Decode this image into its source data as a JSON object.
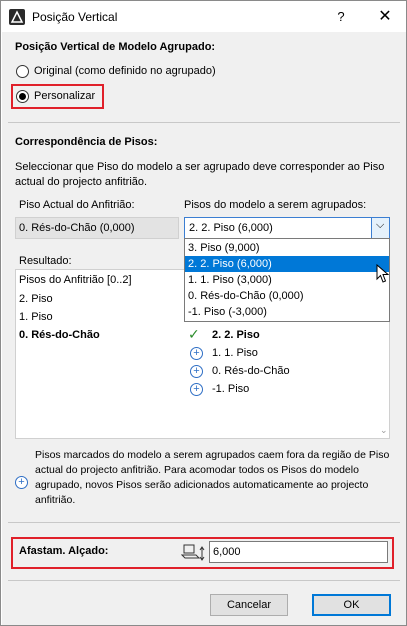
{
  "window": {
    "title": "Posição Vertical",
    "help_label": "?",
    "close_label": "✕"
  },
  "grouped_position": {
    "heading": "Posição Vertical de Modelo Agrupado:",
    "option_original": "Original (como definido no agrupado)",
    "option_custom": "Personalizar",
    "selected": "custom"
  },
  "floors": {
    "heading": "Correspondência de Pisos:",
    "description": "Seleccionar que Piso do modelo a ser agrupado deve corresponder ao Piso actual do projecto anfitrião.",
    "host_label": "Piso Actual do Anfitrião:",
    "host_value": "0. Rés-do-Chão (0,000)",
    "model_label": "Pisos do modelo a serem agrupados:",
    "model_value": "2. 2. Piso (6,000)",
    "dropdown_options": [
      "3. Piso (9,000)",
      "2. 2. Piso (6,000)",
      "1. 1. Piso (3,000)",
      "0. Rés-do-Chão (0,000)",
      "-1. Piso (-3,000)"
    ],
    "dropdown_selected_index": 1
  },
  "result": {
    "label": "Resultado:",
    "host_list": [
      "Pisos do Anfitrião [0..2]",
      "2. Piso",
      "1. Piso",
      "0. Rés-do-Chão"
    ],
    "model_list": [
      "2. 2. Piso",
      "1. 1. Piso",
      "0. Rés-do-Chão",
      "-1. Piso"
    ],
    "matched_model_index": 0
  },
  "info": {
    "note": "Pisos marcados do modelo a serem agrupados caem fora da região de Piso actual do projecto anfitrião. Para acomodar todos os Pisos do modelo agrupado, novos Pisos serão adicionados automaticamente ao projecto anfitrião."
  },
  "offset": {
    "label": "Afastam. Alçado:",
    "value": "6,000"
  },
  "buttons": {
    "cancel": "Cancelar",
    "ok": "OK"
  },
  "colors": {
    "highlight_red": "#e0202a",
    "selection_blue": "#0078d7",
    "plus_blue": "#2f6fc5",
    "check_green": "#2a8c2a"
  }
}
